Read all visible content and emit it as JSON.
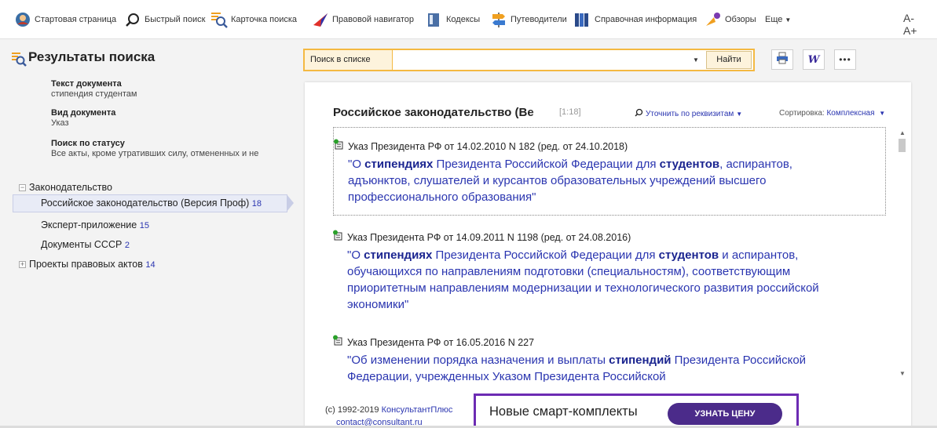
{
  "toolbar": {
    "items": [
      {
        "label": "Стартовая страница",
        "icon": "home-icon"
      },
      {
        "label": "Быстрый поиск",
        "icon": "search-icon"
      },
      {
        "label": "Карточка поиска",
        "icon": "search-card-icon"
      },
      {
        "label": "Правовой навигатор",
        "icon": "navigator-icon"
      },
      {
        "label": "Кодексы",
        "icon": "codex-icon"
      },
      {
        "label": "Путеводители",
        "icon": "guides-icon"
      },
      {
        "label": "Справочная информация",
        "icon": "reference-icon"
      },
      {
        "label": "Обзоры",
        "icon": "reviews-icon"
      },
      {
        "label": "Еще",
        "icon": "chevron-down-icon"
      }
    ],
    "font_decrease": "A-",
    "font_increase": "A+"
  },
  "left": {
    "title": "Результаты поиска",
    "criteria": [
      {
        "label": "Текст документа",
        "value": "стипендия студентам"
      },
      {
        "label": "Вид документа",
        "value": "Указ"
      },
      {
        "label": "Поиск по статусу",
        "value": "Все акты, кроме утративших силу, отмененных и не"
      }
    ],
    "tree": {
      "legislation": "Законодательство",
      "items": [
        {
          "label": "Российское законодательство (Версия Проф)",
          "count": "18"
        },
        {
          "label": "Эксперт-приложение",
          "count": "15"
        },
        {
          "label": "Документы СССР",
          "count": "2"
        }
      ],
      "projects": "Проекты правовых актов",
      "projects_count": "14"
    }
  },
  "search": {
    "label": "Поиск в списке",
    "value": "",
    "button": "Найти"
  },
  "main": {
    "title": "Российское законодательство (Ве",
    "range": "[1:18]",
    "refine": "Уточнить по реквизитам",
    "sort_label": "Сортировка:",
    "sort_value": "Комплексная",
    "docs": [
      {
        "head": "Указ Президента РФ от 14.02.2010 N 182 (ред. от 24.10.2018)",
        "parts": [
          "\"О ",
          "стипендиях",
          " Президента Российской Федерации для ",
          "студентов",
          ", аспирантов, адъюнктов, слушателей и курсантов образовательных учреждений высшего профессионального образования\""
        ]
      },
      {
        "head": "Указ Президента РФ от 14.09.2011 N 1198 (ред. от 24.08.2016)",
        "parts": [
          "\"О ",
          "стипендиях",
          " Президента Российской Федерации для ",
          "студентов",
          " и аспирантов, обучающихся по направлениям подготовки (специальностям), соответствующим приоритетным направлениям модернизации и технологического развития российской экономики\""
        ]
      },
      {
        "head": "Указ Президента РФ от 16.05.2016 N 227",
        "parts": [
          "\"Об изменении порядка назначения и выплаты ",
          "стипендий",
          " Президента Российской Федерации, учрежденных Указом Президента Российской"
        ]
      }
    ]
  },
  "footer": {
    "copyright": "(c) 1992-2019",
    "company": "КонсультантПлюс",
    "email": "contact@consultant.ru"
  },
  "banner": {
    "text": "Новые смарт-комплекты",
    "button": "УЗНАТЬ ЦЕНУ"
  },
  "colors": {
    "link": "#2a35b0",
    "accent": "#f4b942",
    "banner_border": "#6c2bb3",
    "banner_button": "#4b2b8a"
  }
}
